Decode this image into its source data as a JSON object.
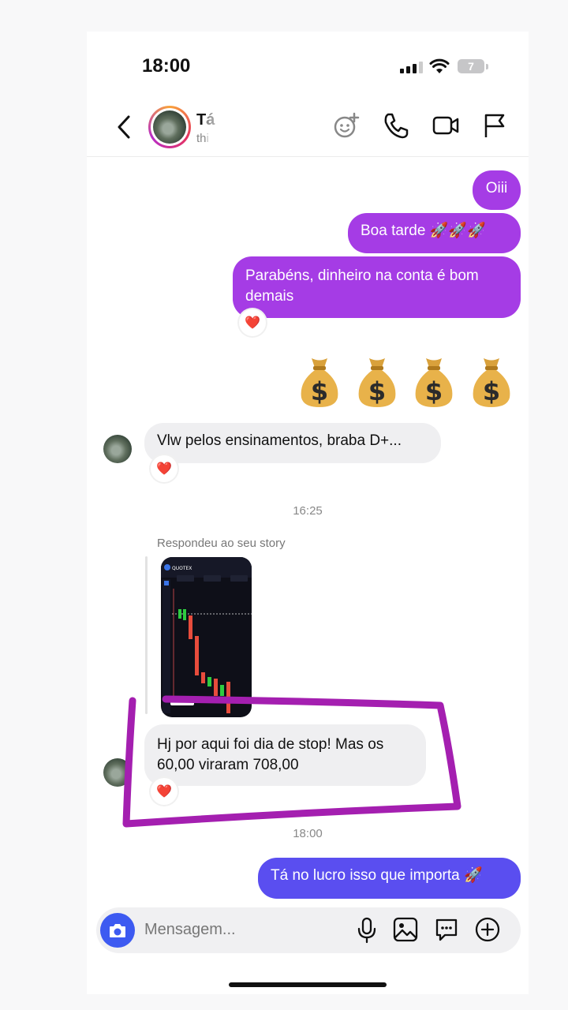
{
  "status_bar": {
    "time": "18:00",
    "battery": "7"
  },
  "header": {
    "contact_name": "Tá",
    "contact_handle": "thi"
  },
  "messages": {
    "out_1": "Oiii",
    "out_2": "Boa tarde 🚀🚀🚀",
    "out_3": "Parabéns, dinheiro na conta é bom demais",
    "in_1": "Vlw pelos ensinamentos, braba D+...",
    "story_reply_label": "Respondeu ao seu story",
    "in_2": "Hj por aqui foi dia de stop! Mas os 60,00 viraram 708,00",
    "out_4": "Tá no lucro isso que importa 🚀"
  },
  "timestamps": {
    "t1": "16:25",
    "t2": "18:00"
  },
  "reactions": {
    "emoji": "❤️"
  },
  "story": {
    "app_name": "QUOTEX"
  },
  "composer": {
    "placeholder": "Mensagem..."
  },
  "colors": {
    "outgoing_purple": "#a53ce5",
    "outgoing_blue": "#5a4ef0",
    "incoming_gray": "#efeff1",
    "annotation_magenta": "#a41fb0"
  }
}
